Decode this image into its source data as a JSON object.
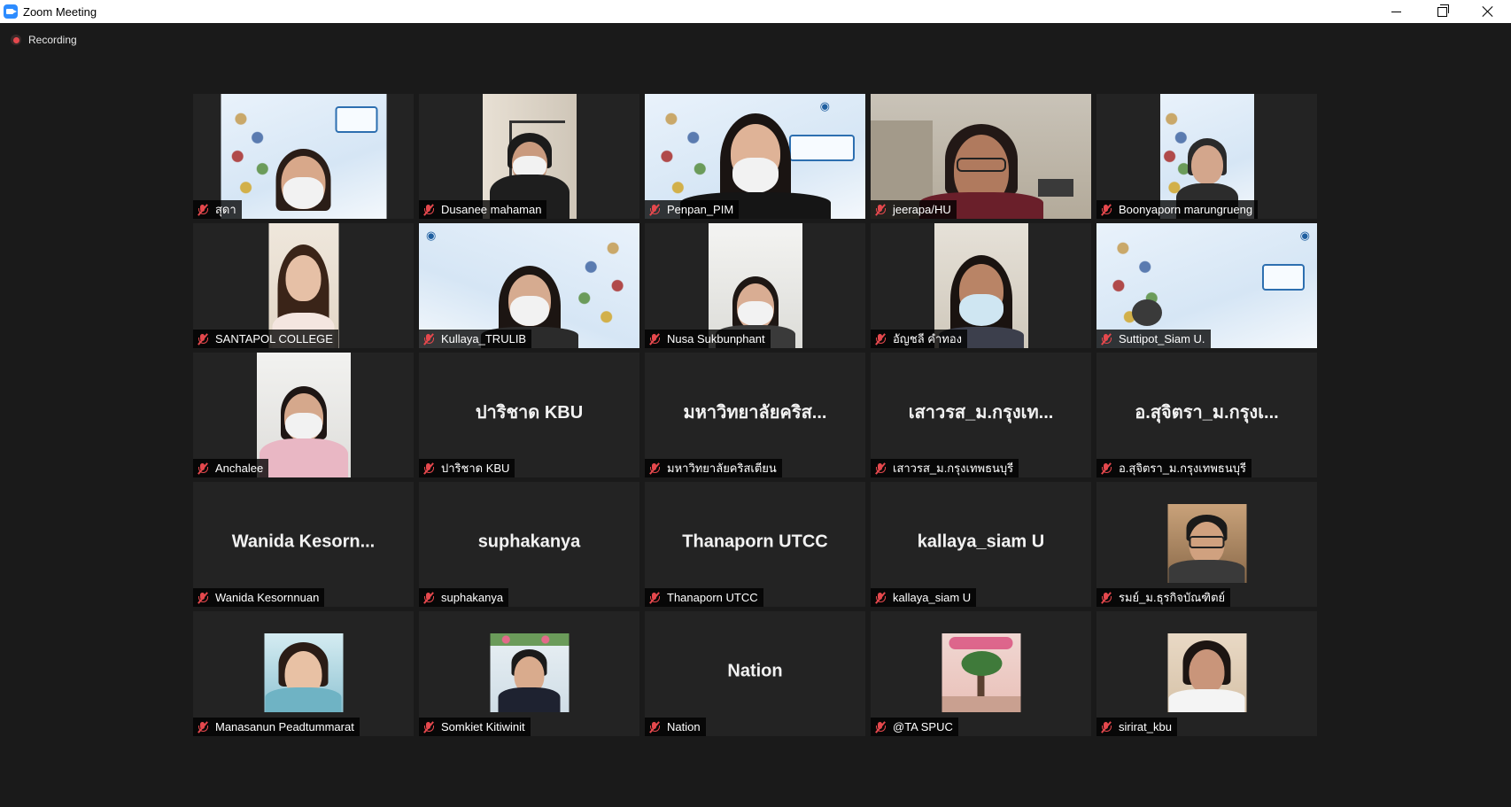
{
  "window": {
    "title": "Zoom Meeting"
  },
  "recording": {
    "label": "Recording"
  },
  "participants": [
    {
      "name": "สุดา"
    },
    {
      "name": "Dusanee mahaman"
    },
    {
      "name": "Penpan_PIM"
    },
    {
      "name": "jeerapa/HU"
    },
    {
      "name": "Boonyaporn marungrueng"
    },
    {
      "name": "SANTAPOL COLLEGE"
    },
    {
      "name": "Kullaya_TRULIB"
    },
    {
      "name": "Nusa Sukbunphant"
    },
    {
      "name": "อัญชลี คำทอง"
    },
    {
      "name": "Suttipot_Siam U."
    },
    {
      "name": "Anchalee"
    },
    {
      "name": "ปาริชาด KBU",
      "display": "ปาริชาด KBU"
    },
    {
      "name": "มหาวิทยาลัยคริสเตียน",
      "display": "มหาวิทยาลัยคริส..."
    },
    {
      "name": "เสาวรส_ม.กรุงเทพธนบุรี",
      "display": "เสาวรส_ม.กรุงเท..."
    },
    {
      "name": "อ.สุจิตรา_ม.กรุงเทพธนบุรี",
      "display": "อ.สุจิตรา_ม.กรุงเ..."
    },
    {
      "name": "Wanida Kesornnuan",
      "display": "Wanida  Kesorn..."
    },
    {
      "name": "suphakanya",
      "display": "suphakanya"
    },
    {
      "name": "Thanaporn UTCC",
      "display": "Thanaporn UTCC"
    },
    {
      "name": "kallaya_siam U",
      "display": "kallaya_siam U"
    },
    {
      "name": "รมย์_ม.ธุรกิจบัณฑิตย์"
    },
    {
      "name": "Manasanun Peadtummarat"
    },
    {
      "name": "Somkiet Kitiwinit"
    },
    {
      "name": "Nation",
      "display": "Nation"
    },
    {
      "name": "@TA SPUC"
    },
    {
      "name": "sirirat_kbu"
    }
  ]
}
